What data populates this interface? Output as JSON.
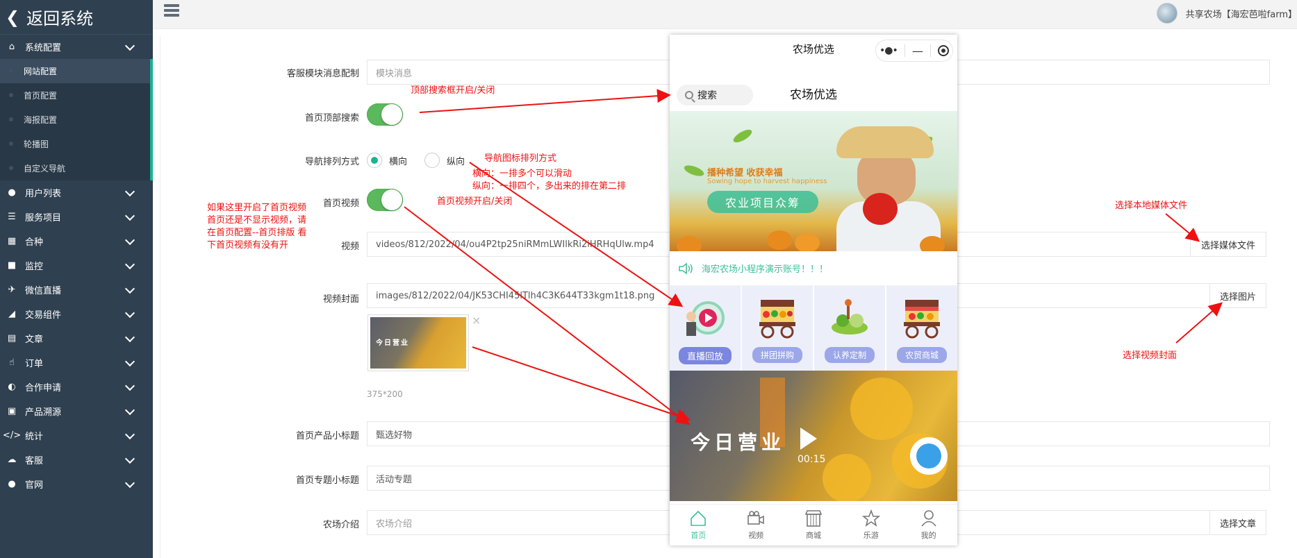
{
  "sidebar": {
    "back_label": "返回系统",
    "items": [
      {
        "label": "系统配置",
        "icon": "home-icon"
      },
      {
        "label": "用户列表",
        "icon": "user-icon"
      },
      {
        "label": "服务项目",
        "icon": "list-icon"
      },
      {
        "label": "合种",
        "icon": "calendar-icon"
      },
      {
        "label": "监控",
        "icon": "camera-icon"
      },
      {
        "label": "微信直播",
        "icon": "plane-icon"
      },
      {
        "label": "交易组件",
        "icon": "eraser-icon"
      },
      {
        "label": "文章",
        "icon": "book-icon"
      },
      {
        "label": "订单",
        "icon": "thumb-icon"
      },
      {
        "label": "合作申请",
        "icon": "contrast-icon"
      },
      {
        "label": "产品溯源",
        "icon": "drive-icon"
      },
      {
        "label": "统计",
        "icon": "code-icon"
      },
      {
        "label": "客服",
        "icon": "chat-icon"
      },
      {
        "label": "官网",
        "icon": "apple-icon"
      }
    ],
    "submenu": [
      "网站配置",
      "首页配置",
      "海报配置",
      "轮播图",
      "自定义导航"
    ]
  },
  "topbar": {
    "user_name": "共享农场【海宏芭啦farm】"
  },
  "form": {
    "msg_label": "客服模块消息配制",
    "msg_placeholder": "模块消息",
    "search_label": "首页顶部搜索",
    "nav_label": "导航排列方式",
    "nav_opt_h": "横向",
    "nav_opt_v": "纵向",
    "video_toggle_label": "首页视频",
    "video_label": "视频",
    "video_value": "videos/812/2022/04/ou4P2tp25niRMmLWIlkRi2iHRHqUlw.mp4",
    "video_button": "选择媒体文件",
    "cover_label": "视频封面",
    "cover_value": "images/812/2022/04/JK53CHI45lTlh4C3K644T33kgm1t18.png",
    "cover_button": "选择图片",
    "thumb_size": "375*200",
    "thumb_close": "×",
    "product_title_label": "首页产品小标题",
    "product_title_value": "甄选好物",
    "topic_title_label": "首页专题小标题",
    "topic_title_value": "活动专题",
    "intro_label": "农场介绍",
    "intro_placeholder": "农场介绍",
    "intro_button": "选择文章"
  },
  "annotations": {
    "search": "顶部搜索框开启/关闭",
    "nav_title": "导航图标排列方式",
    "nav_h": "横向：一排多个可以滑动",
    "nav_v": "纵向：一排四个，多出来的排在第二排",
    "video_toggle": "首页视频开启/关闭",
    "video_note": [
      "如果这里开启了首页视频",
      "首页还是不显示视频，请",
      "在首页配置--首页排版 看",
      "下首页视频有没有开"
    ],
    "media_file": "选择本地媒体文件",
    "cover": "选择视频封面"
  },
  "phone": {
    "nav_title": "农场优选",
    "search_text": "搜索",
    "head_title": "农场优选",
    "banner_line1": "播种希望 收获幸福",
    "banner_line2": "Sowing hope to harvest happiness",
    "banner_pill": "农业项目众筹",
    "notice": "海宏农场小程序演示账号！！！",
    "grid": [
      "直播回放",
      "拼团拼购",
      "认养定制",
      "农贸商城"
    ],
    "video_text": "今日营业",
    "video_time": "00:15",
    "tabs": [
      "首页",
      "视频",
      "商城",
      "乐游",
      "我的"
    ]
  },
  "colors": {
    "sidebar_bg": "#2f4050",
    "accent": "#1ab394",
    "switch_on": "#5cb85c",
    "annotation": "#ee1111"
  }
}
